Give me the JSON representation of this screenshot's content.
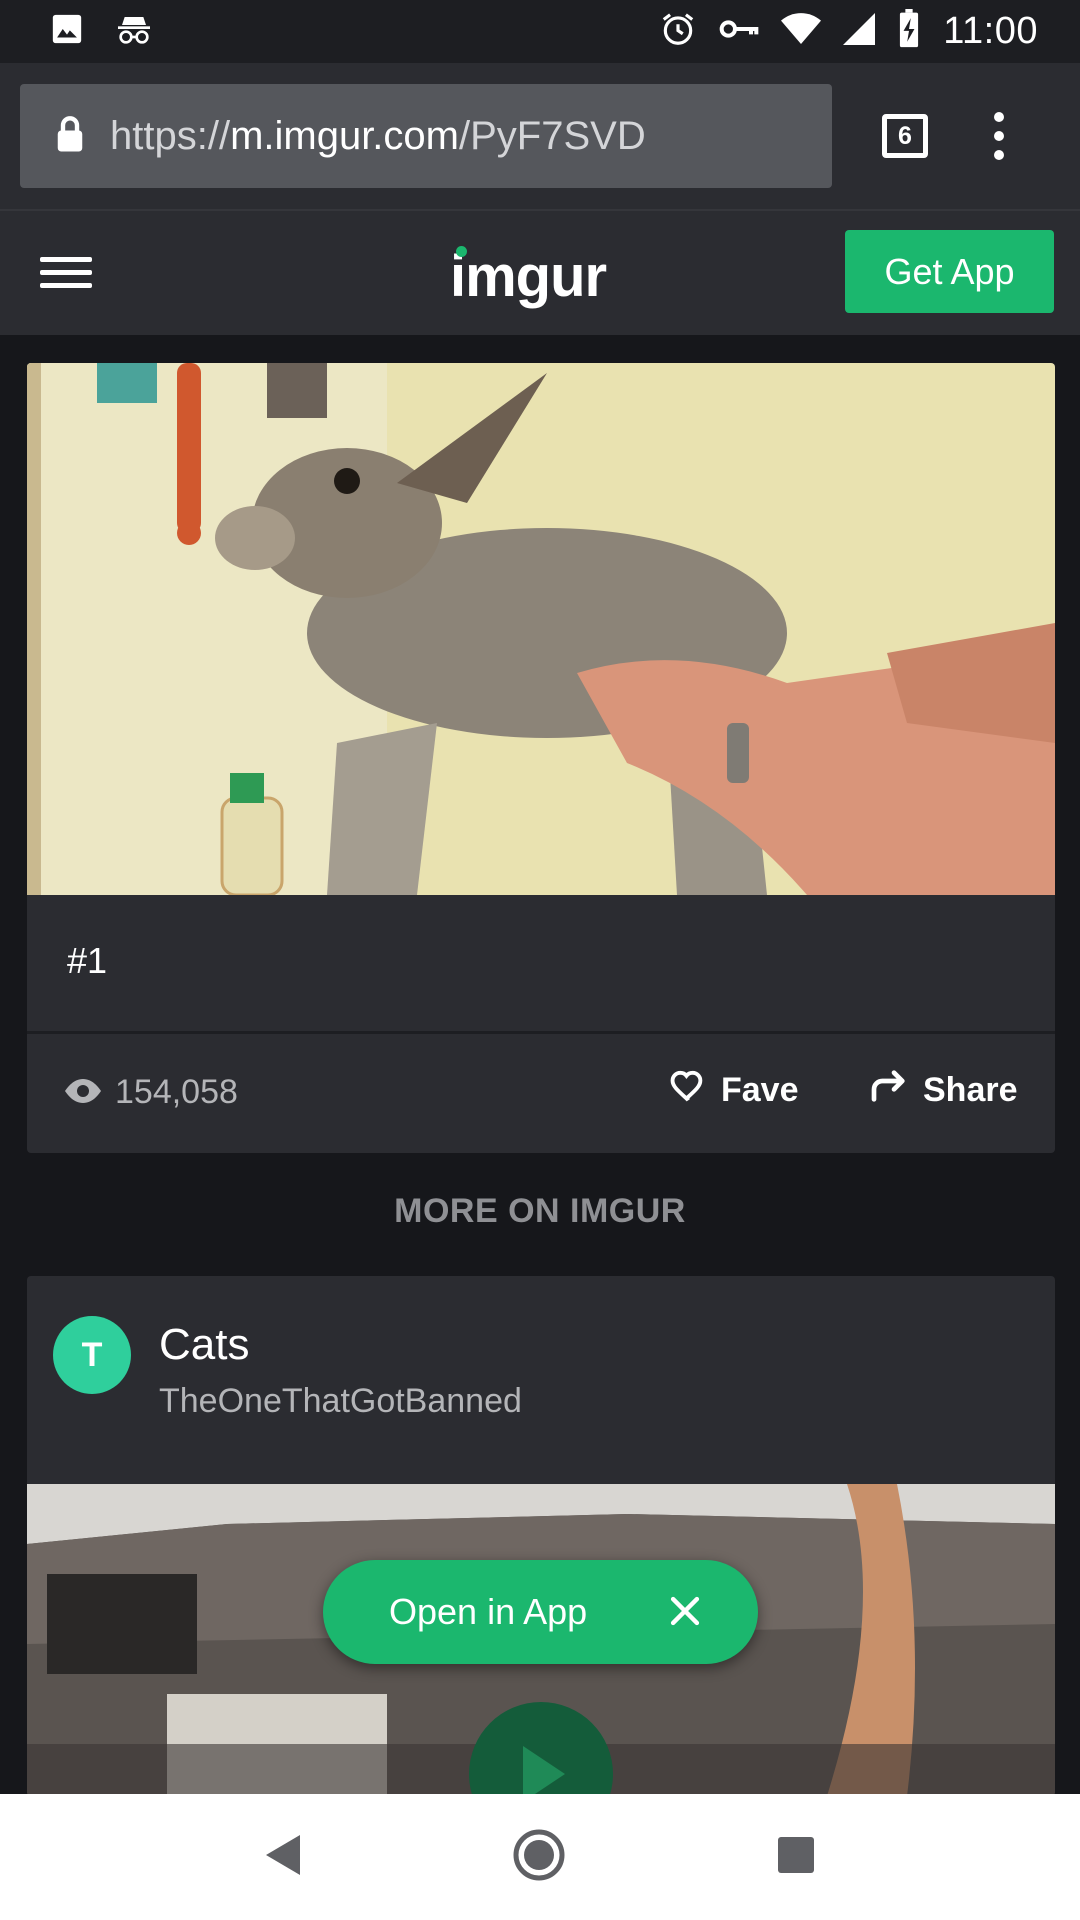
{
  "status_bar": {
    "time": "11:00",
    "left_icons": [
      "image-icon",
      "incognito-icon"
    ],
    "right_icons": [
      "alarm-icon",
      "vpn-key-icon",
      "wifi-icon",
      "signal-icon",
      "battery-charging-icon"
    ]
  },
  "browser": {
    "url_scheme": "https://",
    "url_host": "m.imgur.com",
    "url_path": "/PyF7SVD",
    "tab_count": "6"
  },
  "header": {
    "logo": "imgur",
    "get_app_label": "Get App"
  },
  "post": {
    "caption": "#1",
    "views": "154,058",
    "fave_label": "Fave",
    "share_label": "Share"
  },
  "more_label": "MORE ON IMGUR",
  "gallery_item": {
    "avatar_letter": "T",
    "title": "Cats",
    "username": "TheOneThatGotBanned"
  },
  "open_in_app_label": "Open in App",
  "colors": {
    "accent": "#1bb76e",
    "background": "#16171b",
    "card": "#2b2c31"
  }
}
